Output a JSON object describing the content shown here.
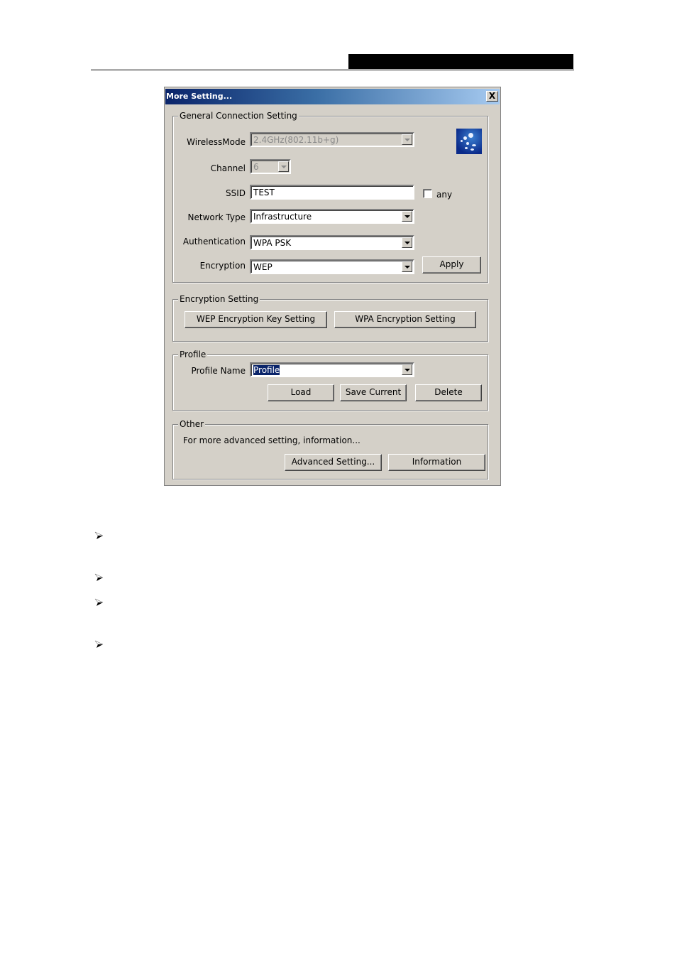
{
  "dialog": {
    "title": "More Setting...",
    "close_label": "X"
  },
  "general": {
    "legend": "General Connection Setting",
    "wireless_mode": {
      "label": "WirelessMode",
      "value": "2.4GHz(802.11b+g)",
      "enabled": false
    },
    "channel": {
      "label": "Channel",
      "value": "6",
      "enabled": false
    },
    "ssid": {
      "label": "SSID",
      "value": "TEST"
    },
    "any": {
      "label": "any",
      "checked": false
    },
    "network_type": {
      "label": "Network Type",
      "value": "Infrastructure"
    },
    "authentication": {
      "label": "Authentication",
      "value": "WPA PSK"
    },
    "encryption": {
      "label": "Encryption",
      "value": "WEP"
    },
    "apply_label": "Apply",
    "logo_icon": "wireless-logo-icon"
  },
  "encryption_setting": {
    "legend": "Encryption Setting",
    "wep_button": "WEP Encryption Key Setting",
    "wpa_button": "WPA Encryption Setting"
  },
  "profile": {
    "legend": "Profile",
    "name_label": "Profile Name",
    "name_value": "Profile",
    "load_label": "Load",
    "save_label": "Save Current",
    "delete_label": "Delete"
  },
  "other": {
    "legend": "Other",
    "description": "For more advanced setting, information...",
    "advanced_label": "Advanced Setting...",
    "information_label": "Information"
  },
  "bullets": {
    "icon": "arrowhead-bullet-icon",
    "count": 4
  }
}
